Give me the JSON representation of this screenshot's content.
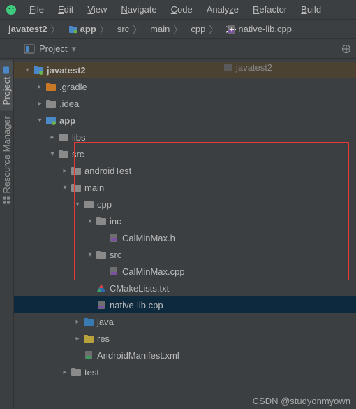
{
  "menu": {
    "items": [
      "File",
      "Edit",
      "View",
      "Navigate",
      "Code",
      "Analyze",
      "Refactor",
      "Build"
    ]
  },
  "breadcrumb": {
    "root": "javatest2",
    "parts": [
      "app",
      "src",
      "main",
      "cpp"
    ],
    "file": "native-lib.cpp"
  },
  "tool_header": {
    "label": "Project"
  },
  "side_tabs": {
    "project": "Project",
    "resmgr": "Resource Manager"
  },
  "open_tab": {
    "label": "javatest2"
  },
  "tree": {
    "root": "javatest2",
    "gradle": ".gradle",
    "idea": ".idea",
    "app": "app",
    "libs": "libs",
    "src": "src",
    "androidTest": "androidTest",
    "main_": "main",
    "cpp": "cpp",
    "inc": "inc",
    "calminmax_h": "CalMinMax.h",
    "src2": "src",
    "calminmax_cpp": "CalMinMax.cpp",
    "cmake": "CMakeLists.txt",
    "nativelib": "native-lib.cpp",
    "java": "java",
    "res": "res",
    "manifest": "AndroidManifest.xml",
    "test": "test"
  },
  "watermark": "CSDN @studyonmyown",
  "colors": {
    "folder": "#8a8a8a",
    "folder_orange": "#c97826",
    "folder_blue": "#3a7ab2",
    "folder_yellow": "#b8a23e",
    "module": "#4a88c7"
  }
}
